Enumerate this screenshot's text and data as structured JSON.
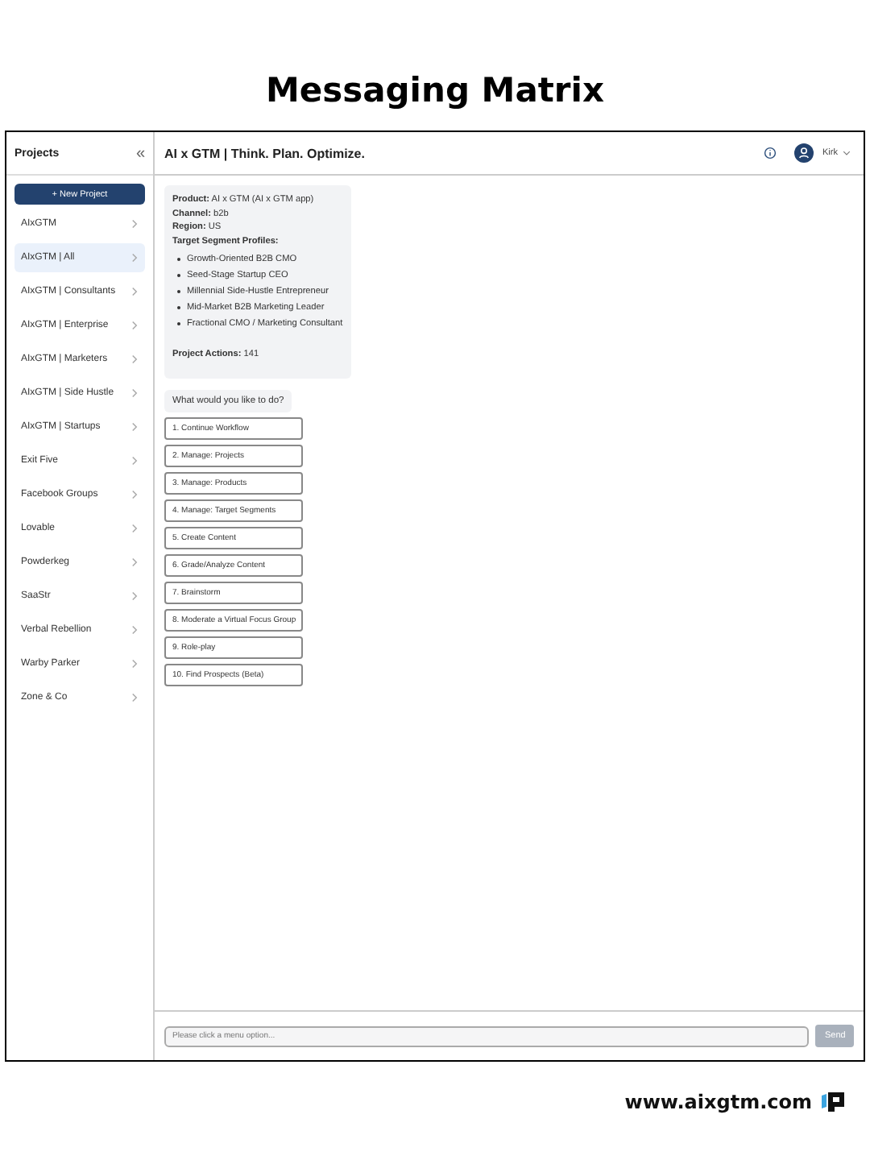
{
  "page_title": "Messaging Matrix",
  "sidebar": {
    "title": "Projects",
    "collapse_icon": "«",
    "new_button": "+ New Project",
    "items": [
      {
        "label": "AIxGTM",
        "selected": false
      },
      {
        "label": "AIxGTM | All",
        "selected": true
      },
      {
        "label": "AIxGTM | Consultants",
        "selected": false
      },
      {
        "label": "AIxGTM | Enterprise",
        "selected": false
      },
      {
        "label": "AIxGTM | Marketers",
        "selected": false
      },
      {
        "label": "AIxGTM | Side Hustle",
        "selected": false
      },
      {
        "label": "AIxGTM | Startups",
        "selected": false
      },
      {
        "label": "Exit Five",
        "selected": false
      },
      {
        "label": "Facebook Groups",
        "selected": false
      },
      {
        "label": "Lovable",
        "selected": false
      },
      {
        "label": "Powderkeg",
        "selected": false
      },
      {
        "label": "SaaStr",
        "selected": false
      },
      {
        "label": "Verbal Rebellion",
        "selected": false
      },
      {
        "label": "Warby Parker",
        "selected": false
      },
      {
        "label": "Zone & Co",
        "selected": false
      }
    ]
  },
  "header": {
    "title": "AI x GTM | Think. Plan. Optimize.",
    "user": "Kirk"
  },
  "summary": {
    "lines": [
      "**Product:** AI x GTM (AI x GTM app)",
      "**Channel:** b2b",
      "**Region:** US",
      "**Target Segment Profiles:**"
    ],
    "profiles": [
      "Growth-Oriented B2B CMO",
      "Seed-Stage Startup CEO",
      "Millennial Side-Hustle Entrepreneur",
      "Mid-Market B2B Marketing Leader",
      "Fractional CMO / Marketing Consultant"
    ],
    "actions": "**Project Actions:** 141"
  },
  "prompt": "What would you like to do?",
  "options": [
    "1. Continue Workflow",
    "2. Manage: Projects",
    "3. Manage: Products",
    "4. Manage: Target Segments",
    "5. Create Content",
    "6. Grade/Analyze Content",
    "7. Brainstorm",
    "8. Moderate a Virtual Focus Group",
    "9. Role-play",
    "10. Find Prospects (Beta)"
  ],
  "input": {
    "placeholder": "Please click a menu option..."
  },
  "send": {
    "label": "Send",
    "disabled": true
  },
  "footer": "www.aixgtm.com"
}
